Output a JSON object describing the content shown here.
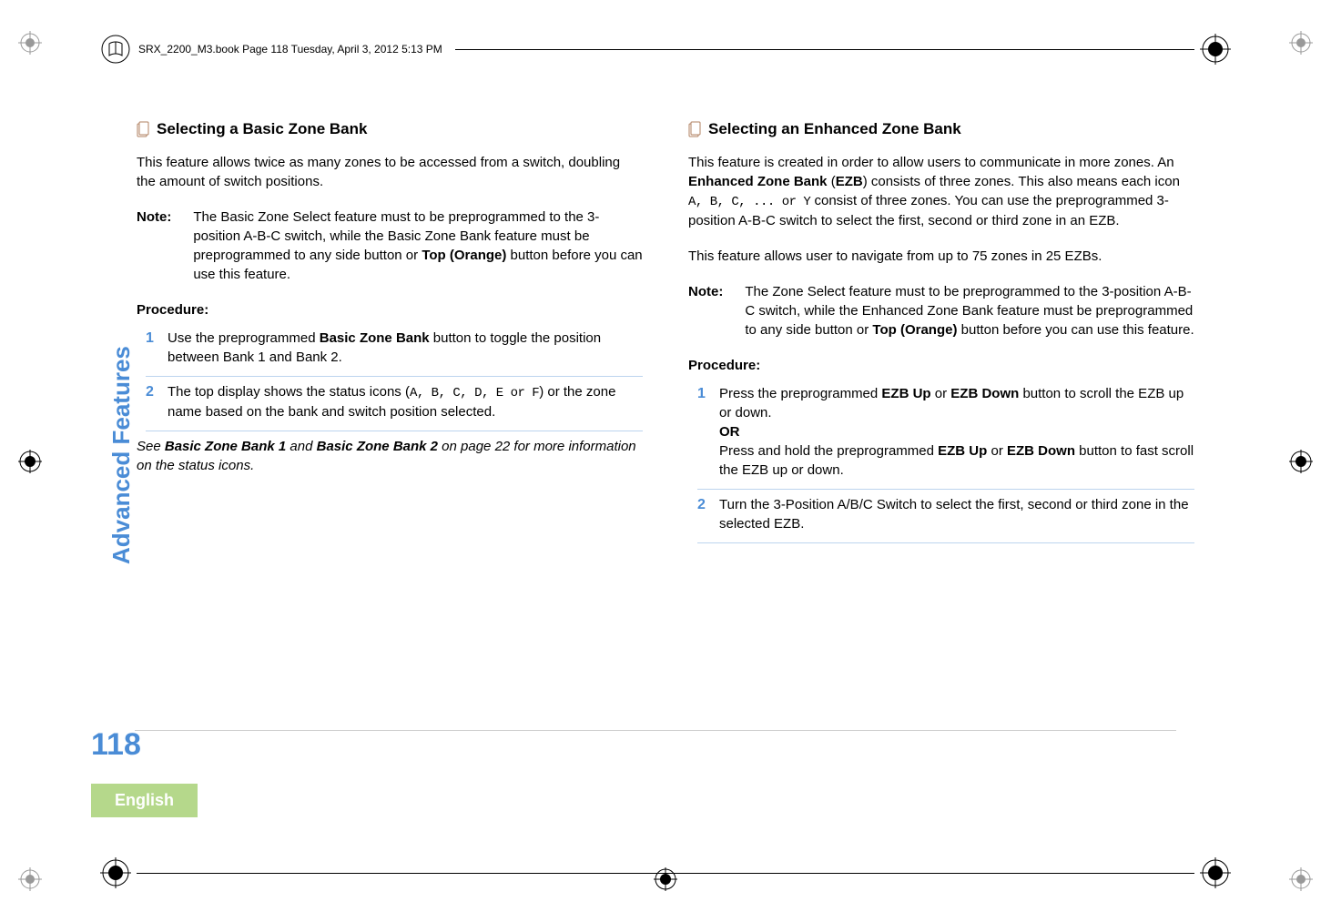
{
  "header_text": "SRX_2200_M3.book  Page 118  Tuesday, April 3, 2012  5:13 PM",
  "side_label": "Advanced Features",
  "page_number": "118",
  "language_badge": "English",
  "left": {
    "heading": "Selecting a Basic Zone Bank",
    "intro": "This feature allows twice as many zones to be accessed from a switch, doubling the amount of switch positions.",
    "note_label": "Note:",
    "note_body_1": "The Basic Zone Select feature must to be preprogrammed to the 3-position A-B-C switch, while the Basic Zone Bank feature must be preprogrammed to any side button or ",
    "note_bold": "Top (Orange)",
    "note_body_2": " button before you can use this feature.",
    "procedure_label": "Procedure:",
    "step1_num": "1",
    "step1_a": "Use the preprogrammed ",
    "step1_b": "Basic Zone Bank",
    "step1_c": " button to toggle the position between Bank 1 and Bank 2.",
    "step2_num": "2",
    "step2_a": "The top display shows the status icons (",
    "step2_icons": "A, B, C, D, E or F",
    "step2_b": ") or the zone name based on the bank and switch position selected.",
    "footnote_a": "See ",
    "footnote_b1": "Basic Zone Bank 1",
    "footnote_c": " and ",
    "footnote_b2": "Basic Zone Bank 2",
    "footnote_d": " on page 22 for more information on the status icons."
  },
  "right": {
    "heading": "Selecting an Enhanced Zone Bank",
    "intro_a": "This feature is created in order to allow users to communicate in more zones. An ",
    "intro_b1": "Enhanced Zone Bank",
    "intro_c": " (",
    "intro_b2": "EZB",
    "intro_d": ") consists of three zones. This also means each icon ",
    "intro_icons": "A, B, C, ... or Y",
    "intro_e": " consist of three zones. You can use the preprogrammed 3-position A-B-C switch to select the first, second or third zone in an EZB.",
    "intro2": "This feature allows user to navigate from up to 75 zones in 25 EZBs.",
    "note_label": "Note:",
    "note_body_1": "The Zone Select feature must to be preprogrammed to the 3-position A-B-C switch, while the Enhanced Zone Bank feature must be preprogrammed to any side button or ",
    "note_bold": "Top (Orange)",
    "note_body_2": " button before you can use this feature.",
    "procedure_label": "Procedure:",
    "step1_num": "1",
    "step1_a": "Press the preprogrammed ",
    "step1_b1": "EZB Up",
    "step1_c": " or ",
    "step1_b2": "EZB Down",
    "step1_d": " button to scroll the EZB up or down.",
    "step1_or": "OR",
    "step1_e": "Press and hold the preprogrammed ",
    "step1_b3": "EZB Up",
    "step1_f": " or ",
    "step1_b4": "EZB Down",
    "step1_g": " button to fast scroll the EZB up or down.",
    "step2_num": "2",
    "step2": "Turn the 3-Position A/B/C Switch to select the first, second or third zone in the selected EZB."
  }
}
